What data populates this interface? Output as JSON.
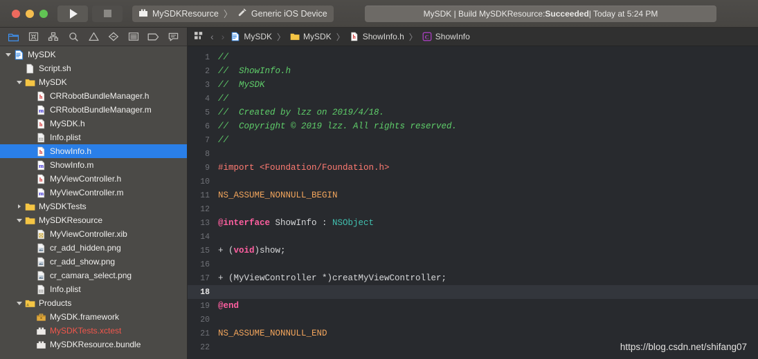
{
  "titlebar": {
    "window_controls": [
      "close",
      "minimize",
      "zoom"
    ],
    "run_button_label": "Run",
    "stop_button_label": "Stop",
    "scheme": "MySDKResource",
    "destination": "Generic iOS Device",
    "scheme_separator": "〉",
    "status": {
      "prefix": "MySDK | Build MySDKResource: ",
      "result": "Succeeded",
      "suffix": " | Today at 5:24 PM"
    }
  },
  "navigator": {
    "toolbar_icons": [
      {
        "name": "project-navigator-icon",
        "label": "Project",
        "active": true
      },
      {
        "name": "source-control-navigator-icon",
        "label": "Source Control",
        "active": false
      },
      {
        "name": "symbol-navigator-icon",
        "label": "Symbols",
        "active": false
      },
      {
        "name": "find-navigator-icon",
        "label": "Find",
        "active": false
      },
      {
        "name": "issue-navigator-icon",
        "label": "Issues",
        "active": false
      },
      {
        "name": "test-navigator-icon",
        "label": "Tests",
        "active": false
      },
      {
        "name": "debug-navigator-icon",
        "label": "Debug",
        "active": false
      },
      {
        "name": "breakpoint-navigator-icon",
        "label": "Breakpoints",
        "active": false
      },
      {
        "name": "report-navigator-icon",
        "label": "Reports",
        "active": false
      }
    ],
    "tree": [
      {
        "label": "MySDK",
        "depth": 0,
        "icon": "xcodeproj-icon",
        "twisty": "open",
        "selected": false
      },
      {
        "label": "Script.sh",
        "depth": 1,
        "icon": "plain-file-icon",
        "twisty": "none",
        "selected": false
      },
      {
        "label": "MySDK",
        "depth": 1,
        "icon": "folder-icon",
        "twisty": "open",
        "selected": false
      },
      {
        "label": "CRRobotBundleManager.h",
        "depth": 2,
        "icon": "header-file-icon",
        "twisty": "none",
        "selected": false
      },
      {
        "label": "CRRobotBundleManager.m",
        "depth": 2,
        "icon": "objc-file-icon",
        "twisty": "none",
        "selected": false
      },
      {
        "label": "MySDK.h",
        "depth": 2,
        "icon": "header-file-icon",
        "twisty": "none",
        "selected": false
      },
      {
        "label": "Info.plist",
        "depth": 2,
        "icon": "plist-file-icon",
        "twisty": "none",
        "selected": false
      },
      {
        "label": "ShowInfo.h",
        "depth": 2,
        "icon": "header-file-icon",
        "twisty": "none",
        "selected": true
      },
      {
        "label": "ShowInfo.m",
        "depth": 2,
        "icon": "objc-file-icon",
        "twisty": "none",
        "selected": false
      },
      {
        "label": "MyViewController.h",
        "depth": 2,
        "icon": "header-file-icon",
        "twisty": "none",
        "selected": false
      },
      {
        "label": "MyViewController.m",
        "depth": 2,
        "icon": "objc-file-icon",
        "twisty": "none",
        "selected": false
      },
      {
        "label": "MySDKTests",
        "depth": 1,
        "icon": "folder-icon",
        "twisty": "closed",
        "selected": false
      },
      {
        "label": "MySDKResource",
        "depth": 1,
        "icon": "folder-icon",
        "twisty": "open",
        "selected": false
      },
      {
        "label": "MyViewController.xib",
        "depth": 2,
        "icon": "xib-file-icon",
        "twisty": "none",
        "selected": false
      },
      {
        "label": "cr_add_hidden.png",
        "depth": 2,
        "icon": "image-file-icon",
        "twisty": "none",
        "selected": false
      },
      {
        "label": "cr_add_show.png",
        "depth": 2,
        "icon": "image-file-icon",
        "twisty": "none",
        "selected": false
      },
      {
        "label": "cr_camara_select.png",
        "depth": 2,
        "icon": "image-file-icon",
        "twisty": "none",
        "selected": false
      },
      {
        "label": "Info.plist",
        "depth": 2,
        "icon": "plist-file-icon",
        "twisty": "none",
        "selected": false
      },
      {
        "label": "Products",
        "depth": 1,
        "icon": "products-folder-icon",
        "twisty": "open",
        "selected": false
      },
      {
        "label": "MySDK.framework",
        "depth": 2,
        "icon": "framework-icon",
        "twisty": "none",
        "selected": false
      },
      {
        "label": "MySDKTests.xctest",
        "depth": 2,
        "icon": "bundle-icon",
        "twisty": "none",
        "selected": false,
        "red": true
      },
      {
        "label": "MySDKResource.bundle",
        "depth": 2,
        "icon": "bundle-icon",
        "twisty": "none",
        "selected": false
      }
    ]
  },
  "editor": {
    "jumpbar": {
      "related_items_label": "Related Items",
      "back_glyph": "‹",
      "forward_glyph": "›",
      "separator": "〉",
      "crumbs": [
        {
          "label": "MySDK",
          "icon": "xcodeproj-icon"
        },
        {
          "label": "MySDK",
          "icon": "folder-icon"
        },
        {
          "label": "ShowInfo.h",
          "icon": "header-file-icon"
        },
        {
          "label": "ShowInfo",
          "icon": "class-symbol-icon"
        }
      ]
    },
    "current_line": 18,
    "lines": [
      {
        "n": 1,
        "tokens": [
          {
            "t": "//",
            "c": "cmt"
          }
        ]
      },
      {
        "n": 2,
        "tokens": [
          {
            "t": "//  ShowInfo.h",
            "c": "cmt"
          }
        ]
      },
      {
        "n": 3,
        "tokens": [
          {
            "t": "//  MySDK",
            "c": "cmt"
          }
        ]
      },
      {
        "n": 4,
        "tokens": [
          {
            "t": "//",
            "c": "cmt"
          }
        ]
      },
      {
        "n": 5,
        "tokens": [
          {
            "t": "//  Created by lzz on 2019/4/18.",
            "c": "cmt"
          }
        ]
      },
      {
        "n": 6,
        "tokens": [
          {
            "t": "//  Copyright © 2019 lzz. All rights reserved.",
            "c": "cmt"
          }
        ]
      },
      {
        "n": 7,
        "tokens": [
          {
            "t": "//",
            "c": "cmt"
          }
        ]
      },
      {
        "n": 8,
        "tokens": []
      },
      {
        "n": 9,
        "tokens": [
          {
            "t": "#import <Foundation/Foundation.h>",
            "c": "pre"
          }
        ]
      },
      {
        "n": 10,
        "tokens": []
      },
      {
        "n": 11,
        "tokens": [
          {
            "t": "NS_ASSUME_NONNULL_BEGIN",
            "c": "macro"
          }
        ]
      },
      {
        "n": 12,
        "tokens": []
      },
      {
        "n": 13,
        "tokens": [
          {
            "t": "@interface",
            "c": "kw"
          },
          {
            "t": " ShowInfo : ",
            "c": "plain"
          },
          {
            "t": "NSObject",
            "c": "type"
          }
        ]
      },
      {
        "n": 14,
        "tokens": []
      },
      {
        "n": 15,
        "tokens": [
          {
            "t": "+ (",
            "c": "plain"
          },
          {
            "t": "void",
            "c": "kw"
          },
          {
            "t": ")show;",
            "c": "plain"
          }
        ]
      },
      {
        "n": 16,
        "tokens": []
      },
      {
        "n": 17,
        "tokens": [
          {
            "t": "+ (MyViewController *)creatMyViewController;",
            "c": "plain"
          }
        ]
      },
      {
        "n": 18,
        "tokens": []
      },
      {
        "n": 19,
        "tokens": [
          {
            "t": "@end",
            "c": "kw"
          }
        ]
      },
      {
        "n": 20,
        "tokens": []
      },
      {
        "n": 21,
        "tokens": [
          {
            "t": "NS_ASSUME_NONNULL_END",
            "c": "macro"
          }
        ]
      },
      {
        "n": 22,
        "tokens": []
      }
    ]
  },
  "watermark": "https://blog.csdn.net/shifang07",
  "colors": {
    "selection_blue": "#2a7fe8",
    "comment_green": "#5fce6a",
    "preprocessor": "#ff7b72",
    "macro_orange": "#f2a55c",
    "keyword_pink": "#ff5fa0",
    "type_teal": "#41c0b0",
    "editor_bg": "#282a2e",
    "navigator_bg": "#4b4a47",
    "titlebar_bg": "#4b4946",
    "error_red": "#f2564c"
  }
}
